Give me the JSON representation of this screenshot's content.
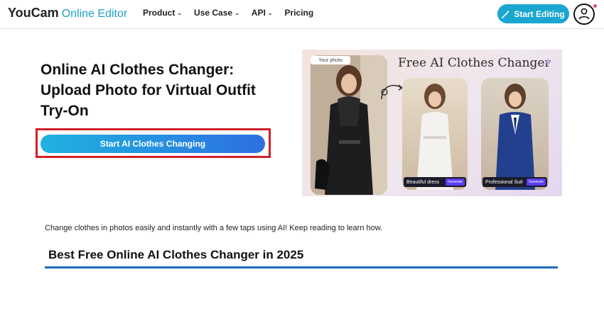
{
  "header": {
    "logo_brand": "YouCam",
    "logo_sub": "Online Editor",
    "nav": [
      {
        "label": "Product",
        "has_dropdown": true
      },
      {
        "label": "Use Case",
        "has_dropdown": true
      },
      {
        "label": "API",
        "has_dropdown": true
      },
      {
        "label": "Pricing",
        "has_dropdown": false
      }
    ],
    "cta_label": "Start Editing",
    "cta_icon": "magic-wand-icon",
    "accent_color": "#1aa6cf",
    "notification_color": "#e9497f"
  },
  "hero": {
    "title": "Online AI Clothes Changer: Upload Photo for Virtual Outfit Try-On",
    "cta_label": "Start AI Clothes Changing",
    "highlight_color": "#d0202a"
  },
  "hero_image": {
    "title": "Free AI Clothes Changer",
    "your_photo_tag": "Your photo",
    "cards": [
      {
        "label": "Beautiful dress",
        "button": "Generate"
      },
      {
        "label": "Professional Suit",
        "button": "Generate"
      }
    ]
  },
  "intro_text": "Change clothes in photos easily and instantly with a few taps using AI! Keep reading to learn how.",
  "section_title": "Best Free Online AI Clothes Changer in 2025",
  "section_rule_color": "#1c6bb8"
}
